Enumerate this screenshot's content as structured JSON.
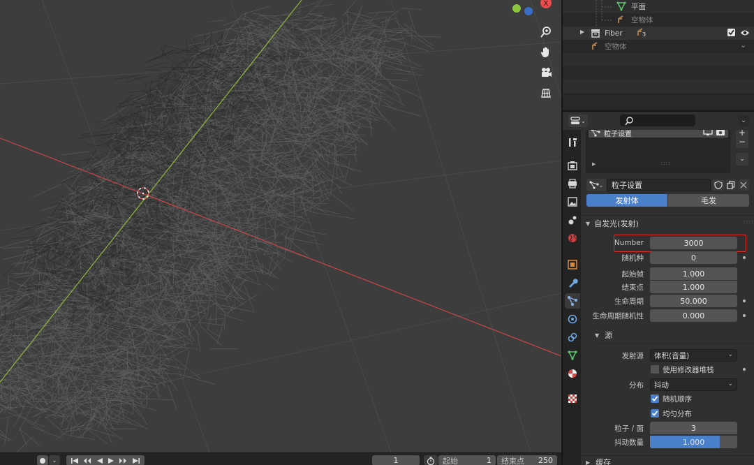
{
  "colors": {
    "accent_blue": "#4a7fc9",
    "highlight_red": "#e0302c",
    "axis_red": "#c84646",
    "axis_green": "#8db83c",
    "gizmo_green": "#8bc53f",
    "gizmo_blue": "#3c6ec8",
    "gizmo_red": "#e84b4b"
  },
  "viewport": {
    "gizmo_x_label": "X",
    "tools": [
      "zoom-icon",
      "hand-icon",
      "camera-icon",
      "grid-icon"
    ]
  },
  "outliner": {
    "rows": [
      {
        "label": "平面",
        "icon": "mesh-icon",
        "dim": false
      },
      {
        "label": "空物体",
        "icon": "empty-icon",
        "dim": true
      },
      {
        "label": "Fiber",
        "icon": "collection-icon",
        "dim": false,
        "badge": "3"
      },
      {
        "label": "空物体",
        "icon": "empty-icon",
        "dim": true
      }
    ]
  },
  "properties": {
    "search_placeholder": "",
    "list_item_label": "粒子设置",
    "datablock_name": "粒子设置",
    "type_tabs": [
      "发射体",
      "毛发"
    ],
    "active_type_tab": 0,
    "emission": {
      "header": "自发光(发射)",
      "rows": [
        {
          "label": "Number",
          "value": "3000"
        },
        {
          "label": "随机种",
          "value": "0"
        },
        {
          "label": "起始帧",
          "value": "1.000"
        },
        {
          "label": "结束点",
          "value": "1.000"
        },
        {
          "label": "生命周期",
          "value": "50.000"
        },
        {
          "label": "生命周期随机性",
          "value": "0.000"
        }
      ]
    },
    "source": {
      "header": "源",
      "emit_from_label": "发射源",
      "emit_from_value": "体积(音量)",
      "use_modifier_stack_label": "使用修改器堆栈",
      "use_modifier_stack": false,
      "distribution_label": "分布",
      "distribution_value": "抖动",
      "random_order_label": "随机顺序",
      "random_order": true,
      "even_distribution_label": "均匀分布",
      "even_distribution": true,
      "particles_per_face_label": "粒子 / 面",
      "particles_per_face_value": "3",
      "jitter_amount_label": "抖动数量",
      "jitter_amount_value": "1.000",
      "jitter_amount_fraction": 1.0
    },
    "cache_header": "缓存"
  },
  "timeline": {
    "current_frame": "1",
    "start_label": "起始",
    "start_value": "1",
    "end_label": "结束点",
    "end_value": "250"
  }
}
